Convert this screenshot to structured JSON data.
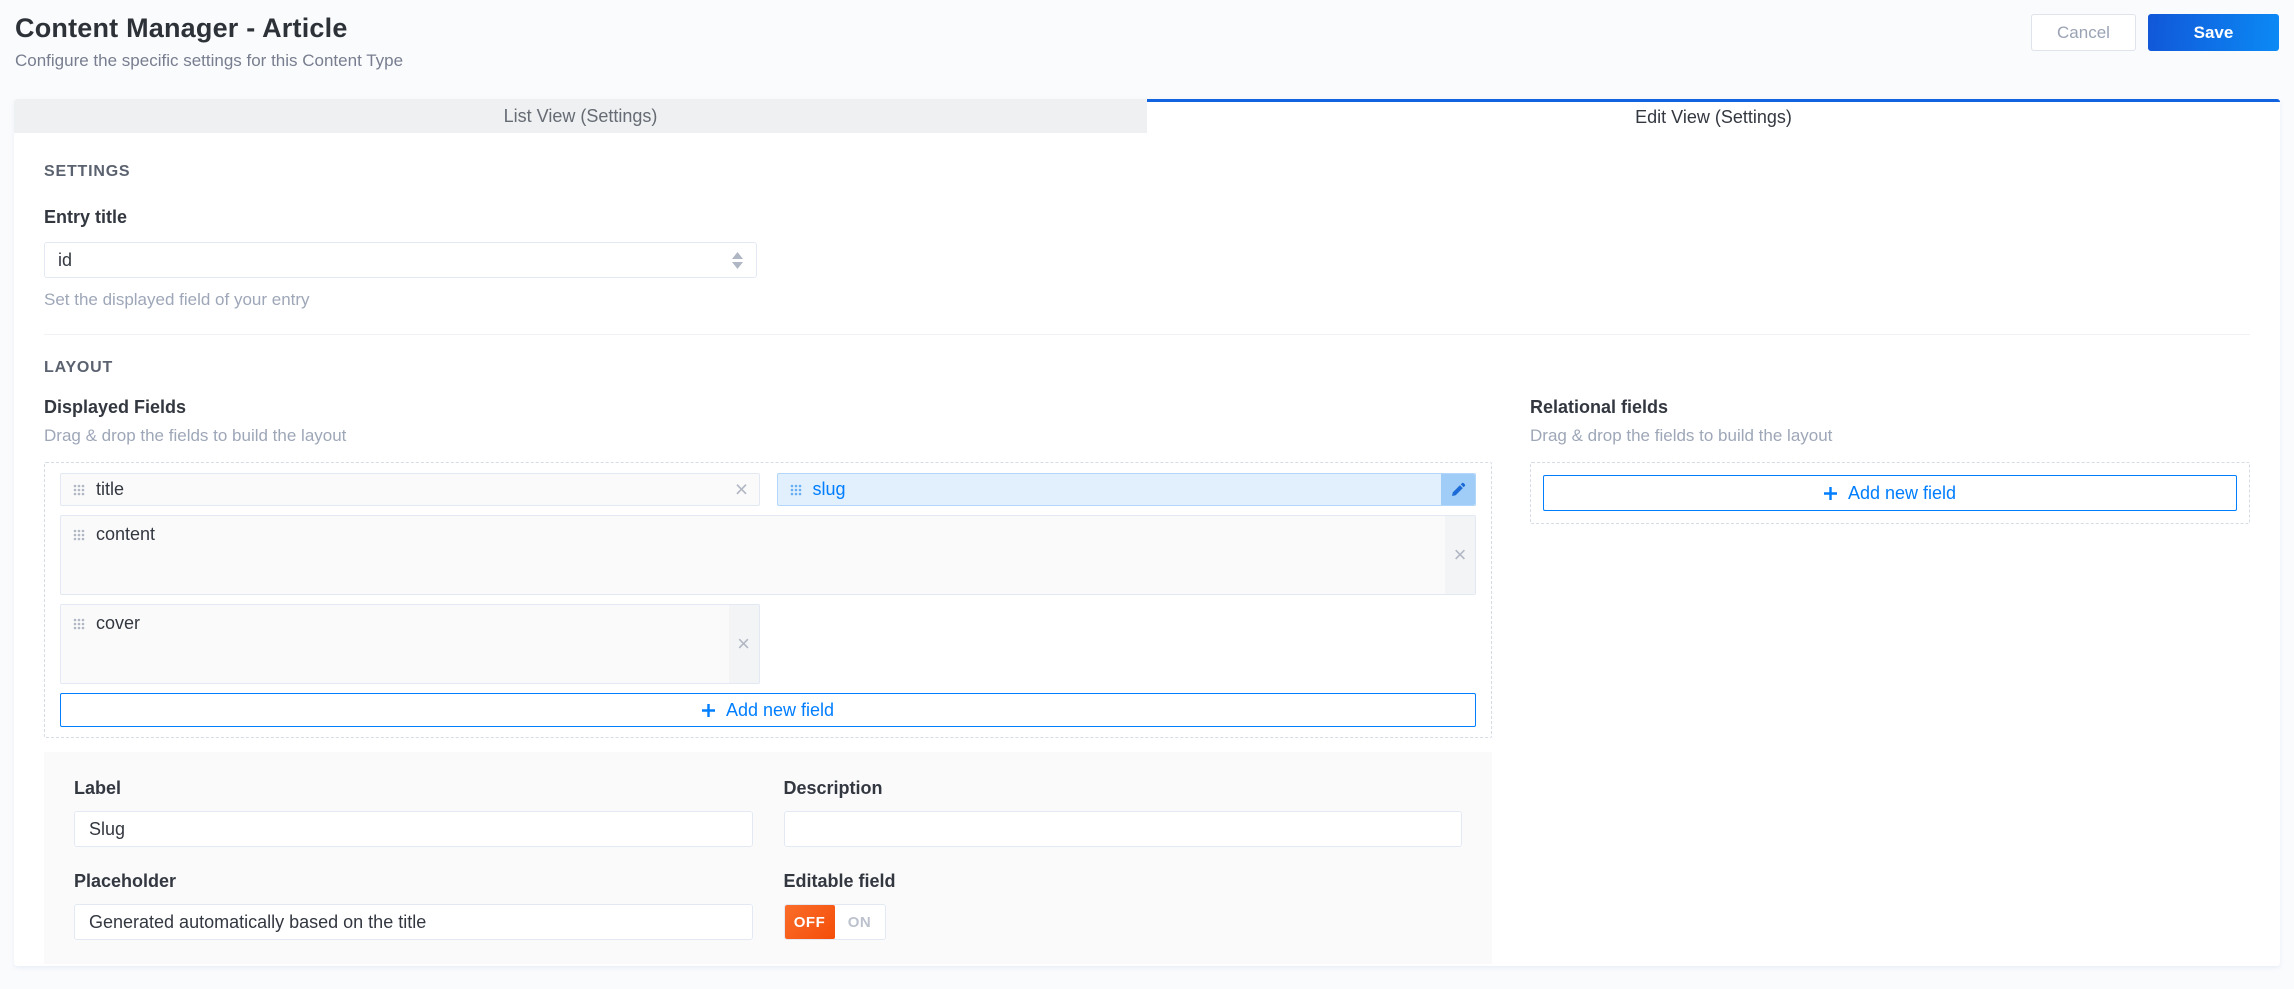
{
  "header": {
    "title": "Content Manager - Article",
    "subtitle": "Configure the specific settings for this Content Type",
    "cancel_label": "Cancel",
    "save_label": "Save"
  },
  "tabs": [
    {
      "label": "List View (Settings)",
      "active": false
    },
    {
      "label": "Edit View (Settings)",
      "active": true
    }
  ],
  "settings": {
    "section_label": "SETTINGS",
    "entry_title_label": "Entry title",
    "entry_title_value": "id",
    "entry_title_help": "Set the displayed field of your entry"
  },
  "layout": {
    "section_label": "LAYOUT",
    "displayed_fields": {
      "title": "Displayed Fields",
      "subtitle": "Drag & drop the fields to build the layout",
      "fields": [
        {
          "name": "title",
          "type": "pill",
          "selected": false
        },
        {
          "name": "slug",
          "type": "pill",
          "selected": true
        },
        {
          "name": "content",
          "type": "block-full",
          "selected": false
        },
        {
          "name": "cover",
          "type": "block-half",
          "selected": false
        }
      ],
      "add_label": "Add new field"
    },
    "relational_fields": {
      "title": "Relational fields",
      "subtitle": "Drag & drop the fields to build the layout",
      "add_label": "Add new field"
    }
  },
  "field_form": {
    "label": {
      "label": "Label",
      "value": "Slug"
    },
    "description": {
      "label": "Description",
      "value": ""
    },
    "placeholder": {
      "label": "Placeholder",
      "value": "Generated automatically based on the title"
    },
    "editable": {
      "label": "Editable field",
      "off_label": "OFF",
      "on_label": "ON",
      "value": "OFF"
    }
  },
  "icons": {
    "drag_handle": "grid-dots",
    "remove": "×",
    "edit": "pencil",
    "add": "plus",
    "select_stepper": "up-down-arrows"
  },
  "colors": {
    "accent_blue": "#007eff",
    "active_tab_blue": "#1163e0",
    "save_gradient_start": "#1157d8",
    "save_gradient_end": "#0b8af5",
    "toggle_off_start": "#fa6d2a",
    "toggle_off_end": "#f44e09",
    "selected_field_bg": "#e2effc",
    "selected_field_edge": "#9fcdf8"
  }
}
